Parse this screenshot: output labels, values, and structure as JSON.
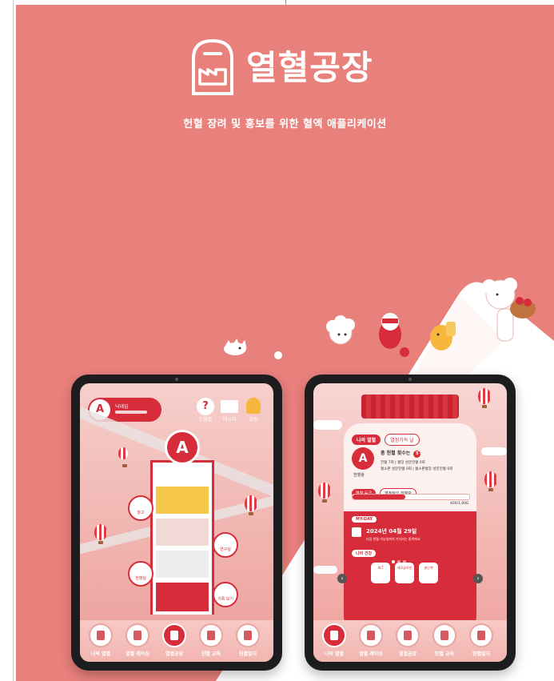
{
  "app": {
    "title": "열혈공장",
    "subtitle": "헌혈 장려 및 홍보를 위한 혈액 애플리케이션",
    "brand_color": "#e8807c",
    "accent_color": "#d72d3a"
  },
  "left_tablet": {
    "blood_type": "A",
    "profile_badge": "A",
    "profile_name": "닉네임",
    "top_icons": [
      {
        "icon": "question-icon",
        "label": "도움말"
      },
      {
        "icon": "mail-icon",
        "label": "메시지"
      },
      {
        "icon": "bell-icon",
        "label": "알림"
      }
    ],
    "floor_bubbles": [
      {
        "label": "창고"
      },
      {
        "label": "연구실"
      },
      {
        "label": "헌혈실"
      },
      {
        "label": "기록 보기"
      }
    ],
    "nav": [
      {
        "label": "나의 열혈"
      },
      {
        "label": "열혈 레이싱"
      },
      {
        "label": "열혈공장"
      },
      {
        "label": "헌혈 교육"
      },
      {
        "label": "헌혈일지"
      }
    ]
  },
  "right_tablet": {
    "tabs": [
      {
        "label": "나의 열혈"
      },
      {
        "label": "열정가득 날"
      }
    ],
    "blood_type": "A",
    "blood_caption": "헌혈왕",
    "count_text": "총 헌혈 횟수는",
    "count_value": "5",
    "info_line_1": "전혈 7회 | 혈장 성분헌혈 0회",
    "info_line_2": "혈소판 성분헌혈 0회 | 혈소판혈장 성분헌혈 0회",
    "grade_label": "열혈 등급",
    "grade_value": "열정적인 헌혈자",
    "progress_fraction": 0.45,
    "progress_text": "400/1,000",
    "myday_label": "MY-DAY",
    "myday_date": "2024년 04월 29일",
    "myday_desc": "다음 헌혈 가능일까지 기다리는 중이에요",
    "health_label": "나의 건강",
    "health_items": [
      {
        "label": "ALT"
      },
      {
        "label": "헤모글로빈"
      },
      {
        "label": "총단백"
      }
    ],
    "nav": [
      {
        "label": "나의 열혈"
      },
      {
        "label": "열혈 레이싱"
      },
      {
        "label": "열혈공장"
      },
      {
        "label": "헌혈 교육"
      },
      {
        "label": "헌혈일지"
      }
    ]
  }
}
